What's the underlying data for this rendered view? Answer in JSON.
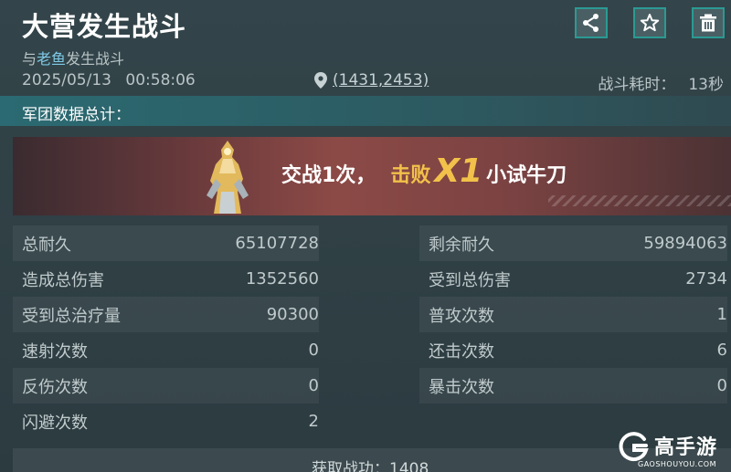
{
  "header": {
    "title": "大营发生战斗",
    "subtitle_prefix": "与",
    "enemy_name": "老鱼",
    "subtitle_suffix": "发生战斗",
    "date": "2025/05/13",
    "time": "00:58:06",
    "location": "(1431,2453)",
    "duration_label": "战斗耗时：",
    "duration_value": "13秒",
    "icons": [
      "share-icon",
      "star-icon",
      "trash-icon"
    ]
  },
  "section": {
    "title": "军团数据总计："
  },
  "banner": {
    "prefix": "交战1次，",
    "defeat": "击败",
    "count": "X1",
    "rank": "小试牛刀"
  },
  "stats": {
    "left": [
      {
        "label": "总耐久",
        "value": "65107728"
      },
      {
        "label": "造成总伤害",
        "value": "1352560"
      },
      {
        "label": "受到总治疗量",
        "value": "90300"
      },
      {
        "label": "速射次数",
        "value": "0"
      },
      {
        "label": "反伤次数",
        "value": "0"
      },
      {
        "label": "闪避次数",
        "value": "2"
      }
    ],
    "right": [
      {
        "label": "剩余耐久",
        "value": "59894063"
      },
      {
        "label": "受到总伤害",
        "value": "2734"
      },
      {
        "label": "普攻次数",
        "value": "1"
      },
      {
        "label": "还击次数",
        "value": "6"
      },
      {
        "label": "暴击次数",
        "value": "0"
      }
    ]
  },
  "footer": {
    "text": "获取战功：1408"
  },
  "watermark": {
    "cn": "高手游",
    "en": "GAOSHOUYOU.COM"
  },
  "colors": {
    "accent_teal": "#2a9a93",
    "highlight_gold": "#f2c14a",
    "name_blue": "#7fc9e6"
  }
}
